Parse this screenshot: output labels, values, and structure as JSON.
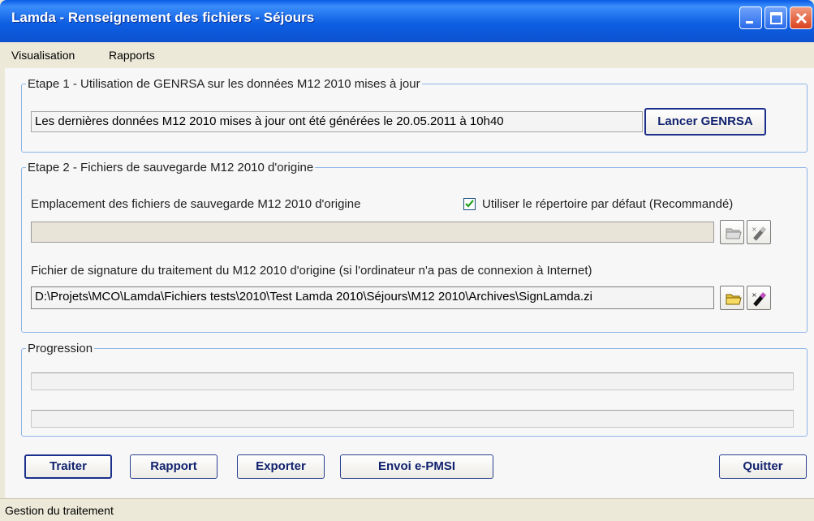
{
  "window": {
    "title": "Lamda - Renseignement des fichiers - Séjours"
  },
  "menu": {
    "items": [
      "Visualisation",
      "Rapports"
    ]
  },
  "step1": {
    "legend": "Etape 1 - Utilisation de GENRSA sur les données M12 2010 mises à jour",
    "status_value": "Les dernières données M12 2010 mises à jour ont été générées le 20.05.2011 à 10h40",
    "launch_button": "Lancer GENRSA"
  },
  "step2": {
    "legend": "Etape 2 - Fichiers de sauvegarde M12 2010 d'origine",
    "location_label": "Emplacement des fichiers de sauvegarde M12 2010 d'origine",
    "default_dir_checkbox_label": "Utiliser le répertoire par défaut (Recommandé)",
    "default_dir_checked": true,
    "location_value": "",
    "signature_label": "Fichier de signature du traitement du M12 2010 d'origine (si l'ordinateur n'a pas de connexion à Internet)",
    "signature_value": "D:\\Projets\\MCO\\Lamda\\Fichiers tests\\2010\\Test Lamda 2010\\Séjours\\M12 2010\\Archives\\SignLamda.zi"
  },
  "progress": {
    "legend": "Progression",
    "bar1_value": 0,
    "bar2_value": 0
  },
  "actions": {
    "treat": "Traiter",
    "report": "Rapport",
    "export": "Exporter",
    "send": "Envoi e-PMSI",
    "quit": "Quitter"
  },
  "status_bar": {
    "text": "Gestion du traitement"
  },
  "colors": {
    "title_bar": "#0B57DC",
    "group_border": "#8FB5E8",
    "button_border": "#1B2F8C"
  }
}
